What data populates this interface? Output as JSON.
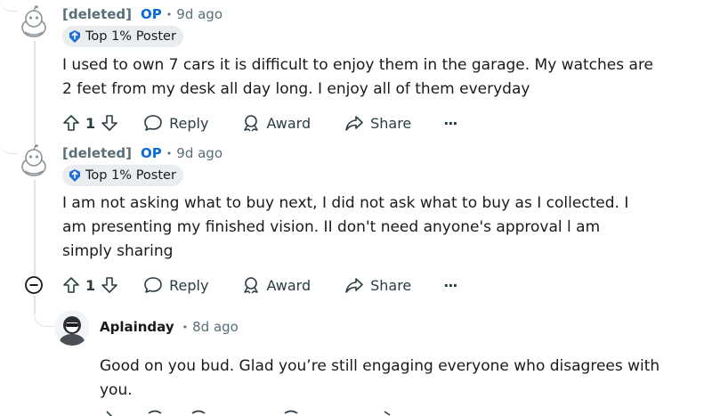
{
  "comments": [
    {
      "author": "[deleted]",
      "op_badge": "OP",
      "separator": "•",
      "time": "9d ago",
      "flair": "Top 1% Poster",
      "body": "I used to own 7 cars it is difficult to enjoy them in the garage. My watches are 2 feet from my desk all day long. I enjoy all of them everyday",
      "votes": "1",
      "reply_label": "Reply",
      "award_label": "Award",
      "share_label": "Share",
      "more_label": "···"
    },
    {
      "author": "[deleted]",
      "op_badge": "OP",
      "separator": "•",
      "time": "9d ago",
      "flair": "Top 1% Poster",
      "body": "I am not asking what to buy next, I did not ask what to buy as I collected. I am presenting my finished vision. II don't need anyone's approval l am simply sharing",
      "votes": "1",
      "reply_label": "Reply",
      "award_label": "Award",
      "share_label": "Share",
      "more_label": "···"
    },
    {
      "author": "Aplainday",
      "separator": "•",
      "time": "8d ago",
      "body": "Good on you bud. Glad you’re still engaging everyone who disagrees with you."
    }
  ],
  "colors": {
    "op": "#0a6bd8",
    "meta": "#576f76",
    "thread_line": "#dfe3e8",
    "flair_bg": "#eaedef"
  }
}
